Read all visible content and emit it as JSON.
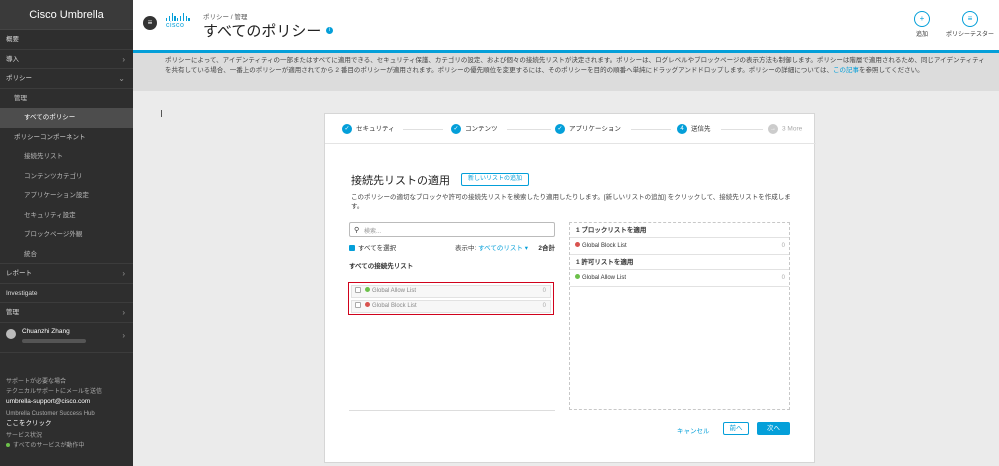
{
  "sidebar": {
    "brand": "Cisco Umbrella",
    "items": [
      {
        "label": "概要",
        "level": 0,
        "chevron": false
      },
      {
        "label": "導入",
        "level": 0,
        "chevron": true
      },
      {
        "label": "ポリシー",
        "level": 0,
        "chevron": true
      },
      {
        "label": "管理",
        "level": 1,
        "chevron": false
      },
      {
        "label": "すべてのポリシー",
        "level": 2,
        "chevron": false,
        "active": true
      },
      {
        "label": "ポリシーコンポーネント",
        "level": 1,
        "chevron": false
      },
      {
        "label": "接続先リスト",
        "level": 2,
        "chevron": false
      },
      {
        "label": "コンテンツカテゴリ",
        "level": 2,
        "chevron": false
      },
      {
        "label": "アプリケーション設定",
        "level": 2,
        "chevron": false
      },
      {
        "label": "セキュリティ設定",
        "level": 2,
        "chevron": false
      },
      {
        "label": "ブロックページ外観",
        "level": 2,
        "chevron": false
      },
      {
        "label": "統合",
        "level": 2,
        "chevron": false
      },
      {
        "label": "レポート",
        "level": 0,
        "chevron": true
      },
      {
        "label": "Investigate",
        "level": 0,
        "chevron": false
      },
      {
        "label": "管理",
        "level": 0,
        "chevron": true
      }
    ],
    "user": {
      "name": "Chuanzhi Zhang"
    },
    "support": {
      "line1": "サポートが必要な場合",
      "line2": "テクニカルサポートにメールを送信",
      "email": "umbrella-support@cisco.com",
      "hub": "Umbrella Customer Success Hub",
      "hub_link": "ここをクリック",
      "status_label": "サービス状況",
      "status": "すべてのサービスが動作中"
    }
  },
  "header": {
    "logo_text": "cisco",
    "breadcrumb": "ポリシー / 管理",
    "title": "すべてのポリシー",
    "title_badge": "i",
    "actions": [
      {
        "label": "追加",
        "icon": "add-icon",
        "glyph": "+"
      },
      {
        "label": "ポリシーテスター",
        "icon": "list-icon",
        "glyph": "≡"
      }
    ]
  },
  "info": {
    "text": "ポリシーによって、アイデンティティの一部またはすべてに適用できる、セキュリティ保護、カテゴリの設定、および個々の接続先リストが決定されます。ポリシーは、ログレベルやブロックページの表示方法も制御します。ポリシーは階層で適用されるため、同じアイデンティティを共有している場合、一番上のポリシーが適用されてから 2 番目のポリシーが適用されます。ポリシーの優先順位を変更するには、そのポリシーを目的の順番へ単純にドラッグアンドドロップします。ポリシーの詳細については、",
    "link": "この記事",
    "suffix": "を参照してください。"
  },
  "wizard": {
    "steps": [
      {
        "label": "セキュリティ",
        "state": "done",
        "glyph": "✓"
      },
      {
        "label": "コンテンツ",
        "state": "done",
        "glyph": "✓"
      },
      {
        "label": "アプリケーション",
        "state": "done",
        "glyph": "✓"
      },
      {
        "label": "送信先",
        "state": "current",
        "glyph": "4"
      },
      {
        "label": "3 More",
        "state": "more",
        "glyph": "→"
      }
    ],
    "section_title": "接続先リストの適用",
    "add_list_button": "新しいリストの追加",
    "description": "このポリシーの適切なブロックや許可の接続先リストを検索したり適用したりします。[新しいリストの追加] をクリックして、接続先リストを作成します。",
    "search_placeholder": "検索...",
    "select_all": "すべてを選択",
    "show_label": "表示中:",
    "show_value": "すべてのリスト ▾",
    "total": "2合計",
    "all_lists_heading": "すべての接続先リスト",
    "lists": [
      {
        "name": "Global Allow List",
        "type": "allow",
        "count": "0"
      },
      {
        "name": "Global Block List",
        "type": "block",
        "count": "0"
      }
    ],
    "applied": [
      {
        "heading": "1 ブロックリストを適用",
        "items": [
          {
            "name": "Global Block List",
            "type": "block",
            "count": "0"
          }
        ]
      },
      {
        "heading": "1 許可リストを適用",
        "items": [
          {
            "name": "Global Allow List",
            "type": "allow",
            "count": "0"
          }
        ]
      }
    ],
    "cancel": "キャンセル",
    "back": "前へ",
    "next": "次へ"
  },
  "colors": {
    "accent": "#049fd9",
    "allow": "#6cc04a",
    "block": "#d9534f",
    "highlight": "#d0021b"
  }
}
